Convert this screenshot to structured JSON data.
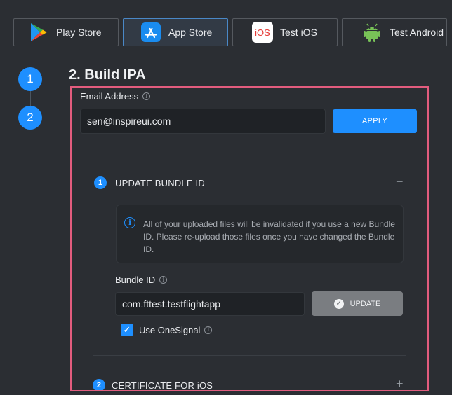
{
  "tabs": [
    {
      "label": "Play Store",
      "icon": "google-play-icon",
      "active": false
    },
    {
      "label": "App Store",
      "icon": "app-store-icon",
      "active": true
    },
    {
      "label": "Test iOS",
      "icon": "ios-icon",
      "icon_text": "iOS",
      "active": false
    },
    {
      "label": "Test Android",
      "icon": "android-icon",
      "active": false
    }
  ],
  "steps": [
    "1",
    "2"
  ],
  "step_title": "2. Build IPA",
  "email": {
    "label": "Email Address",
    "value": "sen@inspireui.com",
    "apply_label": "APPLY"
  },
  "sections": [
    {
      "number": "1",
      "title": "UPDATE BUNDLE ID",
      "toggle": "−",
      "expanded": true
    },
    {
      "number": "2",
      "title": "CERTIFICATE FOR iOS",
      "toggle": "+",
      "expanded": false
    }
  ],
  "notice": "All of your uploaded files will be invalidated if you use a new Bundle ID. Please re-upload those files once you have changed the Bundle ID.",
  "bundle": {
    "label": "Bundle ID",
    "value": "com.fttest.testflightapp",
    "update_label": "UPDATE"
  },
  "onesignal": {
    "label": "Use OneSignal",
    "checked": true
  },
  "colors": {
    "accent": "#1e8fff",
    "highlight_border": "#e25c7e",
    "background": "#2b2e33"
  }
}
